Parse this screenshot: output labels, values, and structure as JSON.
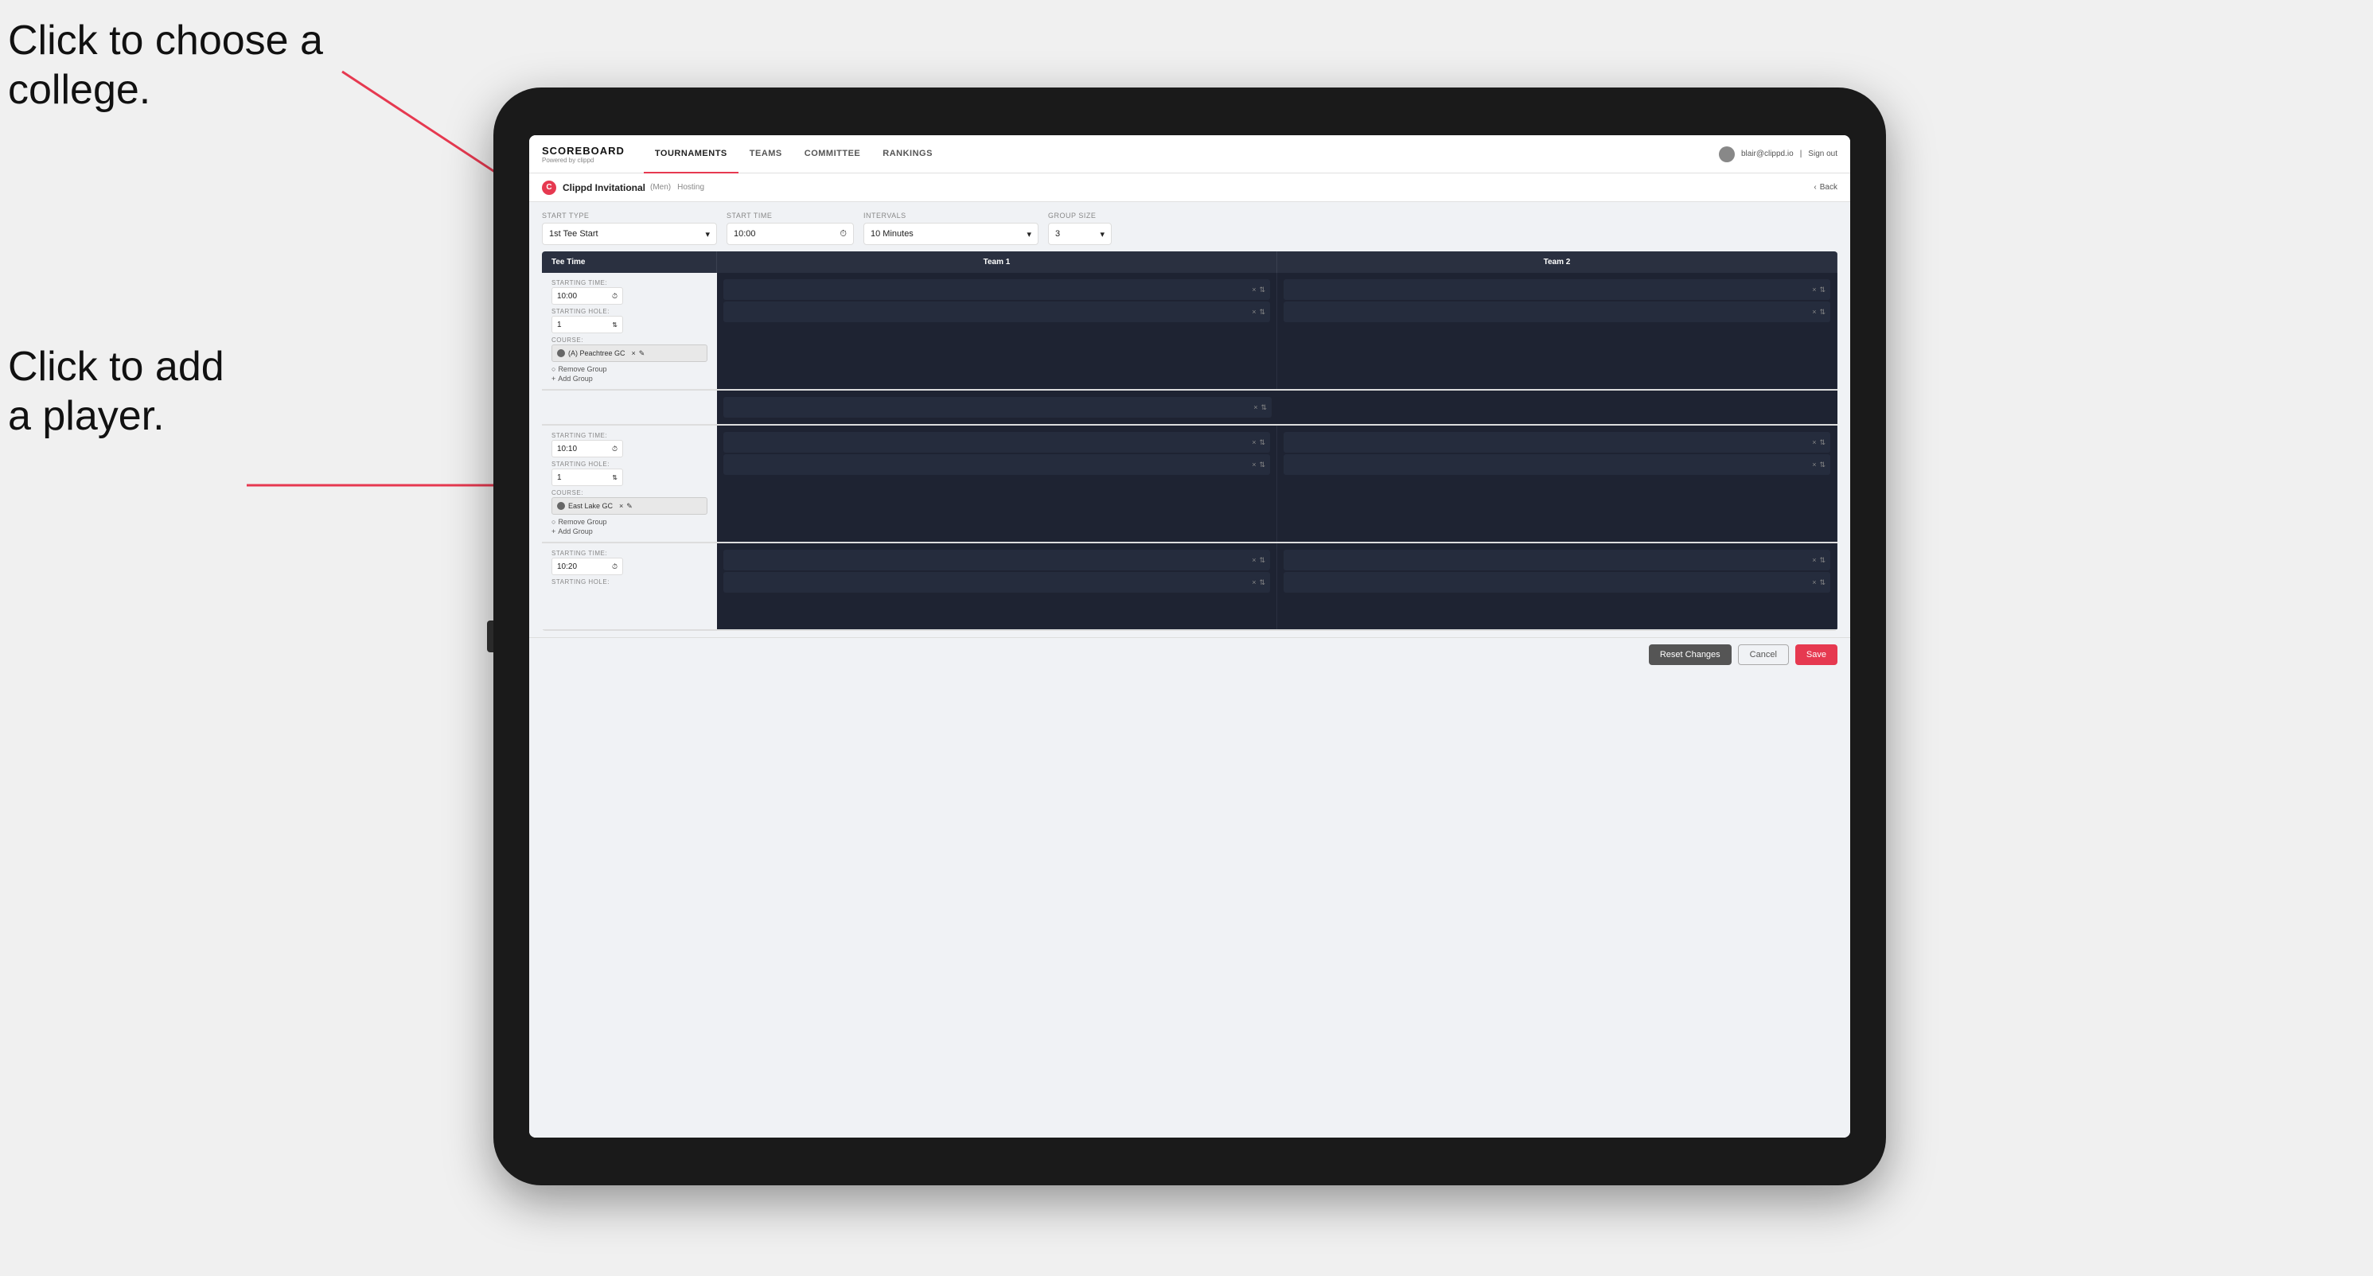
{
  "annotations": {
    "click_college": "Click to choose a\ncollege.",
    "click_player": "Click to add\na player."
  },
  "nav": {
    "logo_title": "SCOREBOARD",
    "logo_subtitle": "Powered by clippd",
    "items": [
      "TOURNAMENTS",
      "TEAMS",
      "COMMITTEE",
      "RANKINGS"
    ],
    "active_item": "TOURNAMENTS",
    "user_email": "blair@clippd.io",
    "sign_out": "Sign out"
  },
  "sub_header": {
    "tournament_name": "Clippd Invitational",
    "gender_badge": "(Men)",
    "hosting_label": "Hosting",
    "back_label": "Back"
  },
  "form": {
    "start_type_label": "Start Type",
    "start_type_value": "1st Tee Start",
    "start_time_label": "Start Time",
    "start_time_value": "10:00",
    "intervals_label": "Intervals",
    "intervals_value": "10 Minutes",
    "group_size_label": "Group Size",
    "group_size_value": "3"
  },
  "table": {
    "col_tee_time": "Tee Time",
    "col_team1": "Team 1",
    "col_team2": "Team 2"
  },
  "groups": [
    {
      "starting_time_label": "STARTING TIME:",
      "starting_time": "10:00",
      "starting_hole_label": "STARTING HOLE:",
      "starting_hole": "1",
      "course_label": "COURSE:",
      "course_name": "(A) Peachtree GC",
      "remove_group": "Remove Group",
      "add_group": "Add Group",
      "team1_slots": 2,
      "team2_slots": 2
    },
    {
      "starting_time_label": "STARTING TIME:",
      "starting_time": "10:10",
      "starting_hole_label": "STARTING HOLE:",
      "starting_hole": "1",
      "course_label": "COURSE:",
      "course_name": "East Lake GC",
      "remove_group": "Remove Group",
      "add_group": "Add Group",
      "team1_slots": 2,
      "team2_slots": 2
    },
    {
      "starting_time_label": "STARTING TIME:",
      "starting_time": "10:20",
      "starting_hole_label": "STARTING HOLE:",
      "starting_hole": "",
      "course_label": "",
      "course_name": "",
      "remove_group": "",
      "add_group": "",
      "team1_slots": 2,
      "team2_slots": 2
    }
  ],
  "footer": {
    "reset_label": "Reset Changes",
    "cancel_label": "Cancel",
    "save_label": "Save"
  }
}
